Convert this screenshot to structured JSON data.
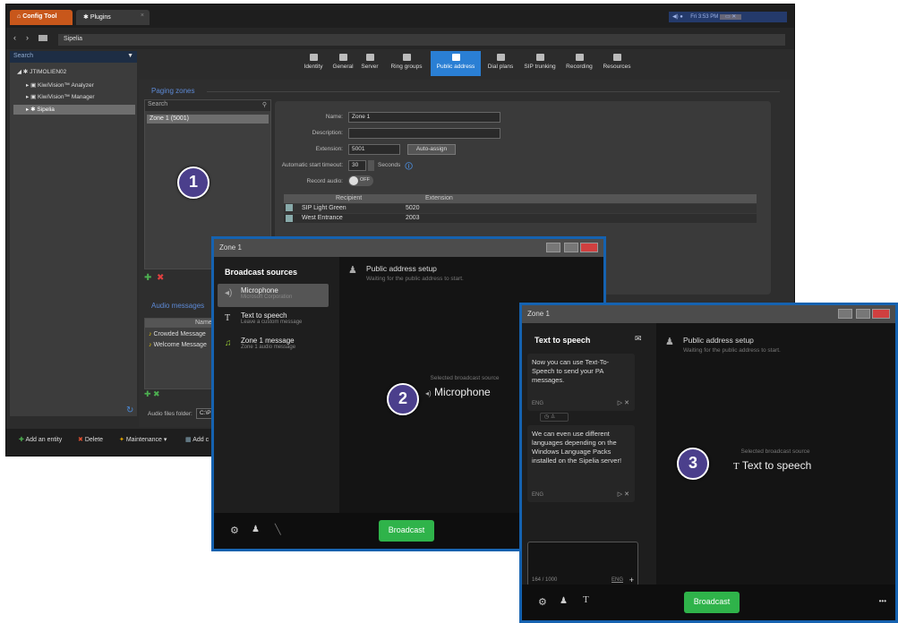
{
  "tabs": {
    "config_tool": "Config Tool",
    "plugins": "Plugins",
    "plugins_close": "×"
  },
  "tray": {
    "time": "Fri 3:53 PM"
  },
  "address": {
    "back": "‹",
    "forward": "›",
    "path": "Sipelia"
  },
  "sidebar": {
    "search_placeholder": "Search",
    "items": [
      {
        "label": "JTIMOLIEN02"
      },
      {
        "label": "KiwiVision™ Analyzer"
      },
      {
        "label": "KiwiVision™ Manager"
      },
      {
        "label": "Sipelia"
      }
    ]
  },
  "toolbar": {
    "items": [
      "Identity",
      "General",
      "Server",
      "Ring groups",
      "Public address",
      "Dial plans",
      "SIP trunking",
      "Recording",
      "Resources"
    ],
    "active": "Public address"
  },
  "paging": {
    "section_title": "Paging zones",
    "search_placeholder": "Search",
    "selected_zone": "Zone 1 (5001)"
  },
  "form": {
    "name_label": "Name:",
    "name_value": "Zone 1",
    "description_label": "Description:",
    "description_value": "",
    "extension_label": "Extension:",
    "extension_value": "5001",
    "auto_assign": "Auto-assign",
    "timeout_label": "Automatic start timeout:",
    "timeout_value": "30",
    "timeout_unit": "Seconds",
    "record_label": "Record audio:",
    "record_state": "OFF",
    "grid_headers": [
      "Recipient",
      "Extension"
    ],
    "grid_rows": [
      {
        "recipient": "SIP Light Green",
        "extension": "5020"
      },
      {
        "recipient": "West Entrance",
        "extension": "2003"
      }
    ]
  },
  "audio": {
    "section_title": "Audio messages",
    "column_name": "Name",
    "items": [
      "Crowded Message",
      "Welcome Message"
    ],
    "folder_label": "Audio files folder:",
    "folder_value": "C:\\Pro"
  },
  "bottom": {
    "add_entity": "Add an entity",
    "delete": "Delete",
    "maintenance": "Maintenance ▾",
    "add_other": "Add c"
  },
  "dlg2": {
    "title": "Zone 1",
    "sources_title": "Broadcast sources",
    "sources": [
      {
        "title": "Microphone",
        "sub": "Microsoft Corporation"
      },
      {
        "title": "Text to speech",
        "sub": "Leave a custom message"
      },
      {
        "title": "Zone 1 message",
        "sub": "Zone 1 audio message"
      }
    ],
    "pa_title": "Public address setup",
    "pa_sub": "Waiting for the public address to start.",
    "selected_label": "Selected broadcast source",
    "selected_value": "Microphone",
    "broadcast": "Broadcast"
  },
  "dlg3": {
    "title": "Zone 1",
    "tts_title": "Text to speech",
    "messages": [
      "Now you can use Text-To-Speech to send your PA messages.",
      "We can even use different languages depending on the Windows Language Packs installed on the Sipelia server!"
    ],
    "lang": "ENG",
    "counter": "164 / 1000",
    "pa_title": "Public address setup",
    "pa_sub": "Waiting for the public address to start.",
    "selected_label": "Selected broadcast source",
    "selected_value": "Text to speech",
    "broadcast": "Broadcast",
    "more": "•••"
  },
  "badges": [
    "1",
    "2",
    "3"
  ]
}
